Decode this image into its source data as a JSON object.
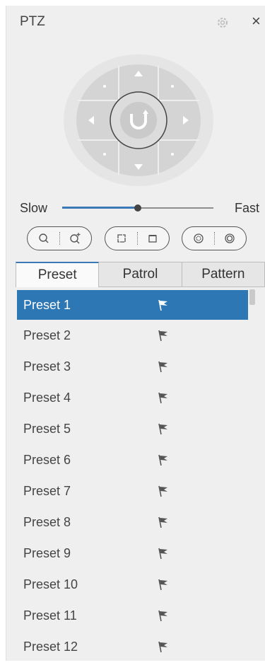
{
  "header": {
    "title": "PTZ",
    "settings_icon": "gear-icon",
    "close_label": "×"
  },
  "speed": {
    "slow_label": "Slow",
    "fast_label": "Fast",
    "value_fraction": 0.5
  },
  "controls": {
    "zoom": [
      "zoom-out-icon",
      "zoom-in-icon"
    ],
    "focus": [
      "focus-near-icon",
      "focus-far-icon"
    ],
    "iris": [
      "iris-close-icon",
      "iris-open-icon"
    ]
  },
  "tabs": [
    {
      "label": "Preset",
      "active": true
    },
    {
      "label": "Patrol",
      "active": false
    },
    {
      "label": "Pattern",
      "active": false
    }
  ],
  "presets": [
    {
      "label": "Preset 1",
      "selected": true
    },
    {
      "label": "Preset 2"
    },
    {
      "label": "Preset 3"
    },
    {
      "label": "Preset 4"
    },
    {
      "label": "Preset 5"
    },
    {
      "label": "Preset 6"
    },
    {
      "label": "Preset 7"
    },
    {
      "label": "Preset 8"
    },
    {
      "label": "Preset 9"
    },
    {
      "label": "Preset 10"
    },
    {
      "label": "Preset 11"
    },
    {
      "label": "Preset 12"
    }
  ],
  "colors": {
    "accent": "#2e77b5",
    "panel": "#efefef"
  }
}
